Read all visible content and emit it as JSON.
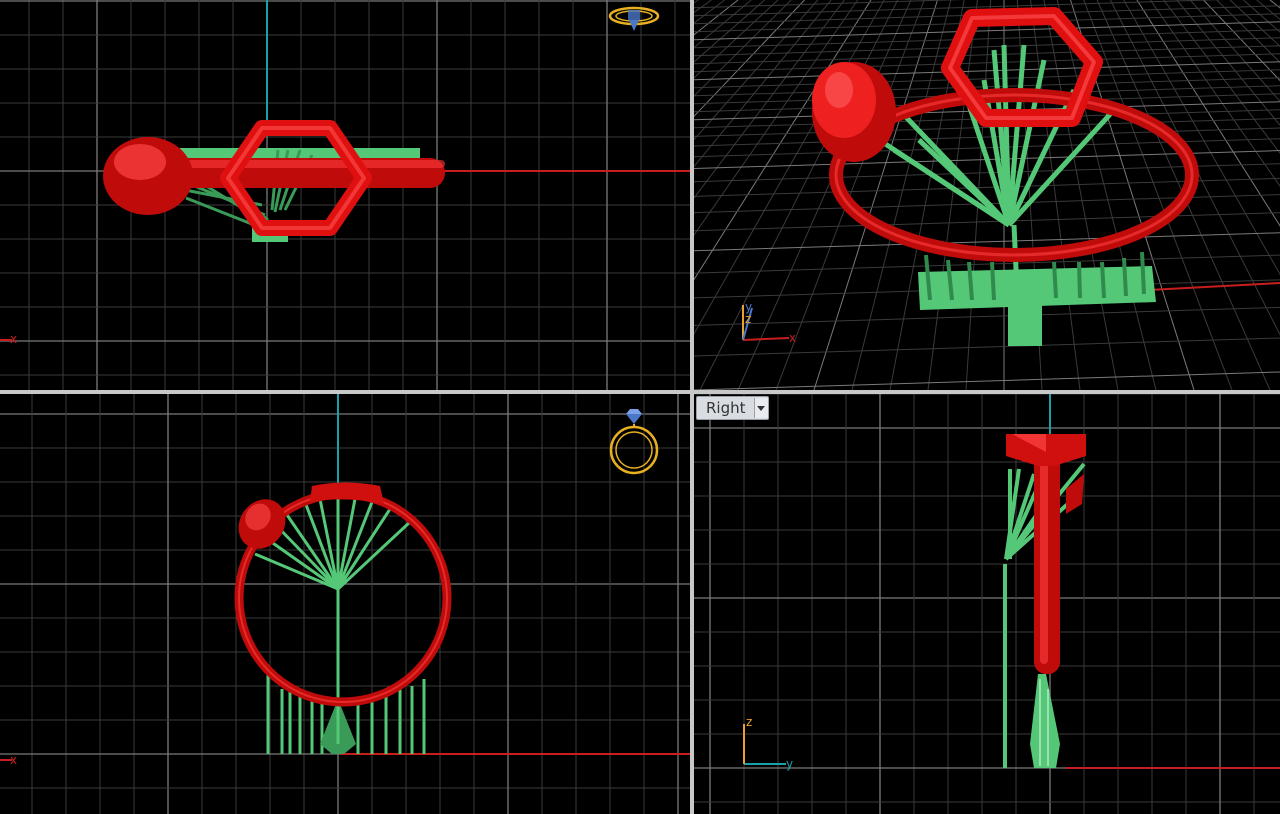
{
  "viewports": {
    "right": {
      "label": "Right"
    }
  },
  "axes": {
    "x": "x",
    "y": "y",
    "z": "z"
  },
  "colors": {
    "background": "#000000",
    "grid_minor": "#3a3a3a",
    "grid_major": "#7a7a7a",
    "axis_x": "#c81e1e",
    "axis_vertical": "#1aa0a8",
    "model_metal": "#e01010",
    "model_supports": "#55c878",
    "gizmo": "#e8b020"
  },
  "icons": [
    "ring-gizmo-icon",
    "dropdown-arrow-icon"
  ]
}
